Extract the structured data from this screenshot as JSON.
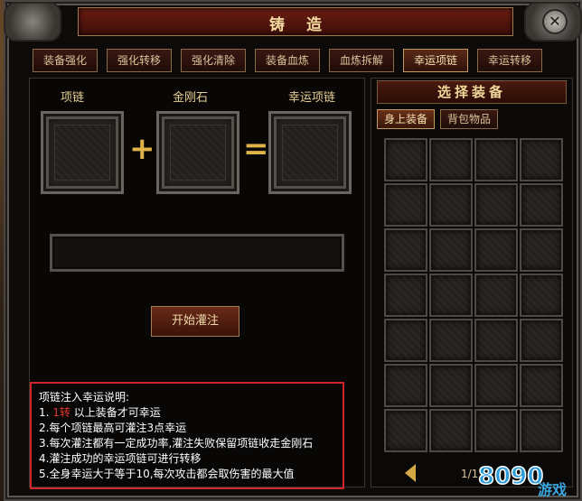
{
  "window": {
    "title": "铸造",
    "tabs": [
      "装备强化",
      "强化转移",
      "强化清除",
      "装备血炼",
      "血炼拆解",
      "幸运项链",
      "幸运转移"
    ],
    "active_tab_index": 5
  },
  "craft": {
    "slot_labels": [
      "项链",
      "金刚石",
      "幸运项链"
    ],
    "plus_symbol": "+",
    "equals_symbol": "=",
    "start_button": "开始灌注"
  },
  "description": {
    "title": "项链注入幸运说明:",
    "line1_prefix": "1.  ",
    "line1_highlight": "1转",
    "line1_suffix": "  以上装备才可幸运",
    "lines": [
      "2.每个项链最高可灌注3点幸运",
      "3.每次灌注都有一定成功率,灌注失败保留项链收走金刚石",
      "4.灌注成功的幸运项链可进行转移",
      "5.全身幸运大于等于10,每次攻击都会取伤害的最大值"
    ],
    "highlight_color": "#e23a2e",
    "border_color": "#d3232b"
  },
  "equipment": {
    "title": "选择装备",
    "tabs": [
      "身上装备",
      "背包物品"
    ],
    "active_tab_index": 0,
    "grid_rows": 7,
    "grid_cols": 4,
    "page_text": "1/1"
  },
  "watermark": {
    "text": "8090",
    "subtext": "游戏"
  }
}
